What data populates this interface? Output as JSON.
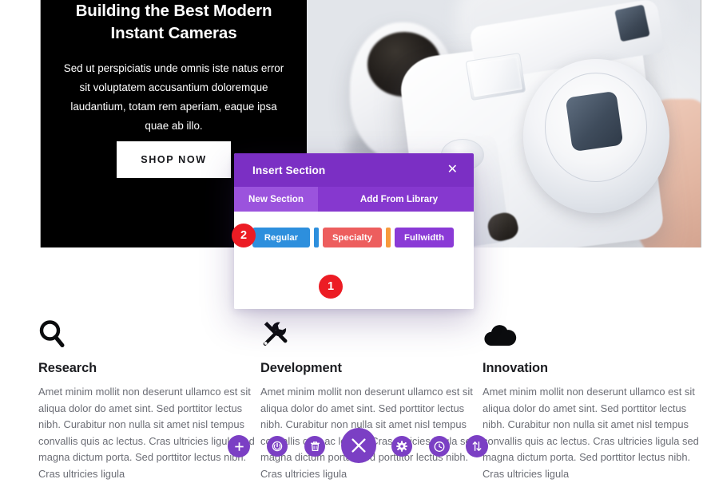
{
  "hero": {
    "title": "Building the Best Modern Instant Cameras",
    "body": "Sed ut perspiciatis unde omnis iste natus error sit voluptatem accusantium doloremque laudantium, totam rem aperiam, eaque ipsa quae ab illo.",
    "cta_label": "SHOP NOW",
    "image_alt": "white-instant-camera-photo"
  },
  "features": [
    {
      "icon": "magnifier-icon",
      "title": "Research",
      "text": "Amet minim mollit non deserunt ullamco est sit aliqua dolor do amet sint. Sed porttitor lectus nibh. Curabitur non nulla sit amet nisl tempus convallis quis ac lectus. Cras ultricies ligula sed magna dictum porta. Sed porttitor lectus nibh. Cras ultricies ligula"
    },
    {
      "icon": "tools-icon",
      "title": "Development",
      "text": "Amet minim mollit non deserunt ullamco est sit aliqua dolor do amet sint. Sed porttitor lectus nibh. Curabitur non nulla sit amet nisl tempus convallis quis ac lectus. Cras ultricies ligula sed magna dictum porta. Sed porttitor lectus nibh. Cras ultricies ligula"
    },
    {
      "icon": "cloud-icon",
      "title": "Innovation",
      "text": "Amet minim mollit non deserunt ullamco est sit aliqua dolor do amet sint. Sed porttitor lectus nibh. Curabitur non nulla sit amet nisl tempus convallis quis ac lectus. Cras ultricies ligula sed magna dictum porta. Sed porttitor lectus nibh. Cras ultricies ligula"
    }
  ],
  "modal": {
    "title": "Insert Section",
    "close_label": "✕",
    "tabs": [
      {
        "label": "New Section",
        "active": true
      },
      {
        "label": "Add From Library",
        "active": false
      }
    ],
    "section_types": [
      {
        "label": "Regular",
        "color": "#2d8fdd"
      },
      {
        "label": "Specialty",
        "color": "#ed5e5e"
      },
      {
        "label": "Fullwidth",
        "color": "#8a3ad6"
      }
    ],
    "header_color": "#7b2fc4",
    "tabbar_color": "#8638cf",
    "active_tab_color": "#9b53dd"
  },
  "annotations": {
    "badges": [
      {
        "number": "1"
      },
      {
        "number": "2"
      }
    ],
    "badge_color": "#ec1c24"
  },
  "add_section_button": {
    "icon": "plus-icon",
    "label": "+",
    "color": "#2f8ad6"
  },
  "toolbar": {
    "color": "#7b3fc4",
    "buttons": [
      {
        "icon": "plus-icon",
        "name": "add-module-button"
      },
      {
        "icon": "power-icon",
        "name": "disable-button"
      },
      {
        "icon": "trash-icon",
        "name": "delete-button"
      },
      {
        "icon": "close-icon",
        "name": "close-button"
      },
      {
        "icon": "gear-icon",
        "name": "settings-button"
      },
      {
        "icon": "clock-icon",
        "name": "history-button"
      },
      {
        "icon": "move-updown-icon",
        "name": "reorder-button"
      }
    ]
  }
}
